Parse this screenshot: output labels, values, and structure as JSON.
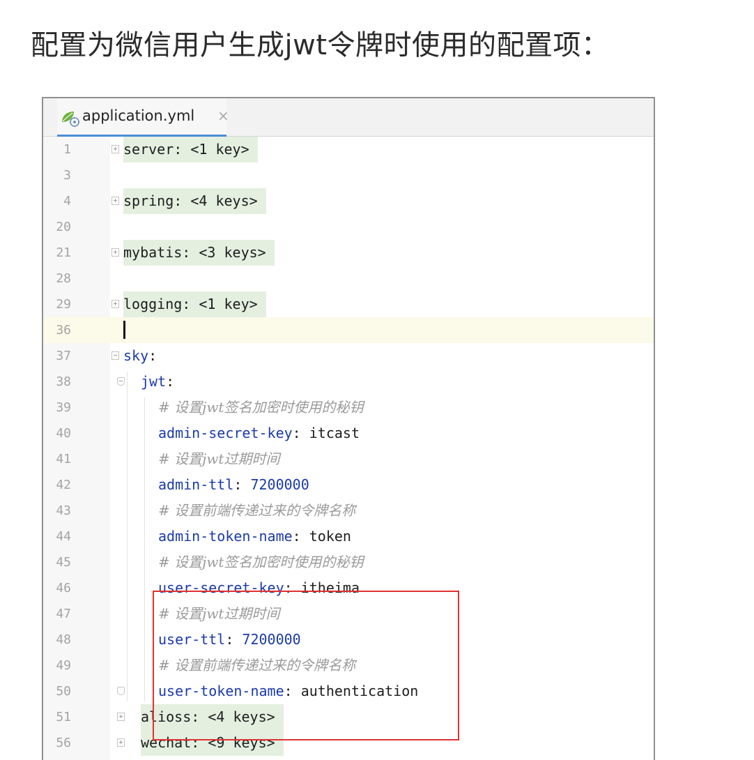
{
  "heading": "配置为微信用户生成jwt令牌时使用的配置项：",
  "editor": {
    "tab": {
      "file_name": "application.yml",
      "icon": "spring-leaf-icon",
      "close_glyph": "×"
    },
    "lines": [
      {
        "num": "1",
        "folded": true,
        "parts": [
          [
            "plain",
            "server: <1 key>"
          ]
        ]
      },
      {
        "num": "3",
        "parts": []
      },
      {
        "num": "4",
        "folded": true,
        "parts": [
          [
            "plain",
            "spring: <4 keys>"
          ]
        ]
      },
      {
        "num": "20",
        "parts": []
      },
      {
        "num": "21",
        "folded": true,
        "parts": [
          [
            "plain",
            "mybatis: <3 keys>"
          ]
        ]
      },
      {
        "num": "28",
        "parts": []
      },
      {
        "num": "29",
        "folded": true,
        "parts": [
          [
            "plain",
            "logging: <1 key>"
          ]
        ]
      },
      {
        "num": "36",
        "current": true,
        "parts": []
      },
      {
        "num": "37",
        "parts": [
          [
            "key",
            "sky"
          ],
          [
            "plain",
            ":"
          ]
        ]
      },
      {
        "num": "38",
        "parts": [
          [
            "key",
            "jwt"
          ],
          [
            "plain",
            ":"
          ]
        ]
      },
      {
        "num": "39",
        "parts": [
          [
            "comment",
            "# 设置jwt签名加密时使用的秘钥"
          ]
        ]
      },
      {
        "num": "40",
        "parts": [
          [
            "key",
            "admin-secret-key"
          ],
          [
            "plain",
            ": itcast"
          ]
        ]
      },
      {
        "num": "41",
        "parts": [
          [
            "comment",
            "# 设置jwt过期时间"
          ]
        ]
      },
      {
        "num": "42",
        "parts": [
          [
            "key",
            "admin-ttl"
          ],
          [
            "plain",
            ": "
          ],
          [
            "num",
            "7200000"
          ]
        ]
      },
      {
        "num": "43",
        "parts": [
          [
            "comment",
            "# 设置前端传递过来的令牌名称"
          ]
        ]
      },
      {
        "num": "44",
        "parts": [
          [
            "key",
            "admin-token-name"
          ],
          [
            "plain",
            ": token"
          ]
        ]
      },
      {
        "num": "45",
        "parts": [
          [
            "comment",
            "# 设置jwt签名加密时使用的秘钥"
          ]
        ]
      },
      {
        "num": "46",
        "parts": [
          [
            "key",
            "user-secret-key"
          ],
          [
            "plain",
            ": itheima"
          ]
        ]
      },
      {
        "num": "47",
        "parts": [
          [
            "comment",
            "# 设置jwt过期时间"
          ]
        ]
      },
      {
        "num": "48",
        "parts": [
          [
            "key",
            "user-ttl"
          ],
          [
            "plain",
            ": "
          ],
          [
            "num",
            "7200000"
          ]
        ]
      },
      {
        "num": "49",
        "parts": [
          [
            "comment",
            "# 设置前端传递过来的令牌名称"
          ]
        ]
      },
      {
        "num": "50",
        "parts": [
          [
            "key",
            "user-token-name"
          ],
          [
            "plain",
            ": authentication"
          ]
        ]
      },
      {
        "num": "51",
        "folded": true,
        "parts": [
          [
            "plain",
            "alioss: <4 keys>"
          ]
        ]
      },
      {
        "num": "56",
        "folded": true,
        "parts": [
          [
            "plain",
            "wechat: <9 keys>"
          ]
        ]
      }
    ]
  },
  "colors": {
    "key": "#1b3aa8",
    "comment": "#9a9a9a",
    "highlight_box": "#e03131",
    "folded_region": "#e4efe0",
    "current_line": "#fcfae8"
  }
}
